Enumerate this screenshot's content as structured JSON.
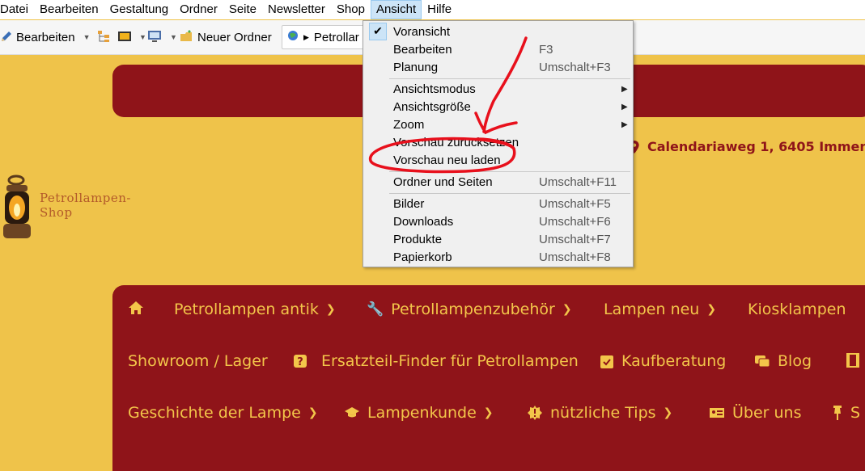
{
  "menubar": {
    "items": [
      "Datei",
      "Bearbeiten",
      "Gestaltung",
      "Ordner",
      "Seite",
      "Newsletter",
      "Shop",
      "Ansicht",
      "Hilfe"
    ],
    "active": "Ansicht"
  },
  "toolbar": {
    "edit_label": "Bearbeiten",
    "new_folder_label": "Neuer Ordner",
    "address_text": "Petrollar"
  },
  "page": {
    "address": "Calendariaweg 1, 6405 Immen",
    "logo_text": "Petrollampen-Shop",
    "logo_line1": "Petrollampen-",
    "logo_line2": "Shop",
    "nav_row1": [
      "Petrollampen antik",
      "Petrollampenzubehör",
      "Lampen neu",
      "Kiosklampen"
    ],
    "nav_row2": [
      "Showroom / Lager",
      "Ersatzteil-Finder für Petrollampen",
      "Kaufberatung",
      "Blog"
    ],
    "nav_row3": [
      "Geschichte der Lampe",
      "Lampenkunde",
      "nützliche Tips",
      "Über uns",
      "S"
    ],
    "accent_red": "#8f1419",
    "accent_yellow": "#efc34a"
  },
  "menu": {
    "items": [
      {
        "label": "Voransicht",
        "shortcut": "",
        "checked": true
      },
      {
        "label": "Bearbeiten",
        "shortcut": "F3"
      },
      {
        "label": "Planung",
        "shortcut": "Umschalt+F3"
      },
      {
        "label": "Ansichtsmodus",
        "shortcut": "",
        "submenu": true
      },
      {
        "label": "Ansichtsgröße",
        "shortcut": "",
        "submenu": true
      },
      {
        "label": "Zoom",
        "shortcut": "",
        "submenu": true
      },
      {
        "label": "Vorschau zurücksetzen",
        "shortcut": ""
      },
      {
        "label": "Vorschau neu laden",
        "shortcut": ""
      },
      {
        "label": "Ordner und Seiten",
        "shortcut": "Umschalt+F11"
      },
      {
        "label": "Bilder",
        "shortcut": "Umschalt+F5"
      },
      {
        "label": "Downloads",
        "shortcut": "Umschalt+F6"
      },
      {
        "label": "Produkte",
        "shortcut": "Umschalt+F7"
      },
      {
        "label": "Papierkorb",
        "shortcut": "Umschalt+F8"
      }
    ]
  },
  "annotation_color": "#e8101c"
}
